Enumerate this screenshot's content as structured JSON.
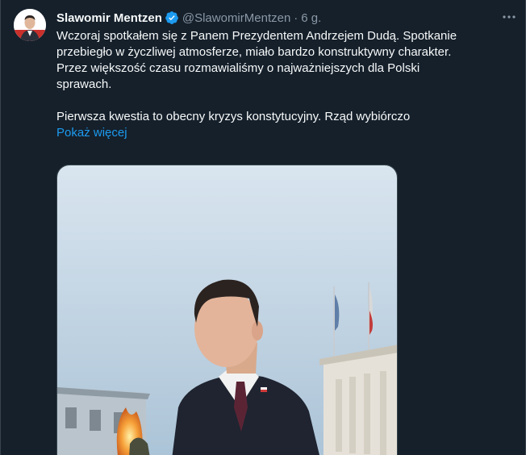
{
  "author": {
    "name": "Slawomir Mentzen",
    "handle": "@SlawomirMentzen",
    "separator": "·",
    "time": "6 g."
  },
  "icons": {
    "verified": "verified-badge-icon",
    "more": "more-options-icon"
  },
  "colors": {
    "background": "#15202b",
    "text": "#f7f9f9",
    "muted": "#8b98a5",
    "accent": "#1d9bf0"
  },
  "tweet": {
    "paragraph1": "Wczoraj spotkałem się z Panem Prezydentem Andrzejem Dudą. Spotkanie\nprzebiegło w życzliwej atmosferze, miało bardzo konstruktywny charakter.\nPrzez większość czasu rozmawialiśmy o najważniejszych dla Polski\nsprawach.",
    "paragraph2": "Pierwsza kwestia to obecny kryzys konstytucyjny. Rząd wybiórczo",
    "show_more": "Pokaż więcej"
  }
}
